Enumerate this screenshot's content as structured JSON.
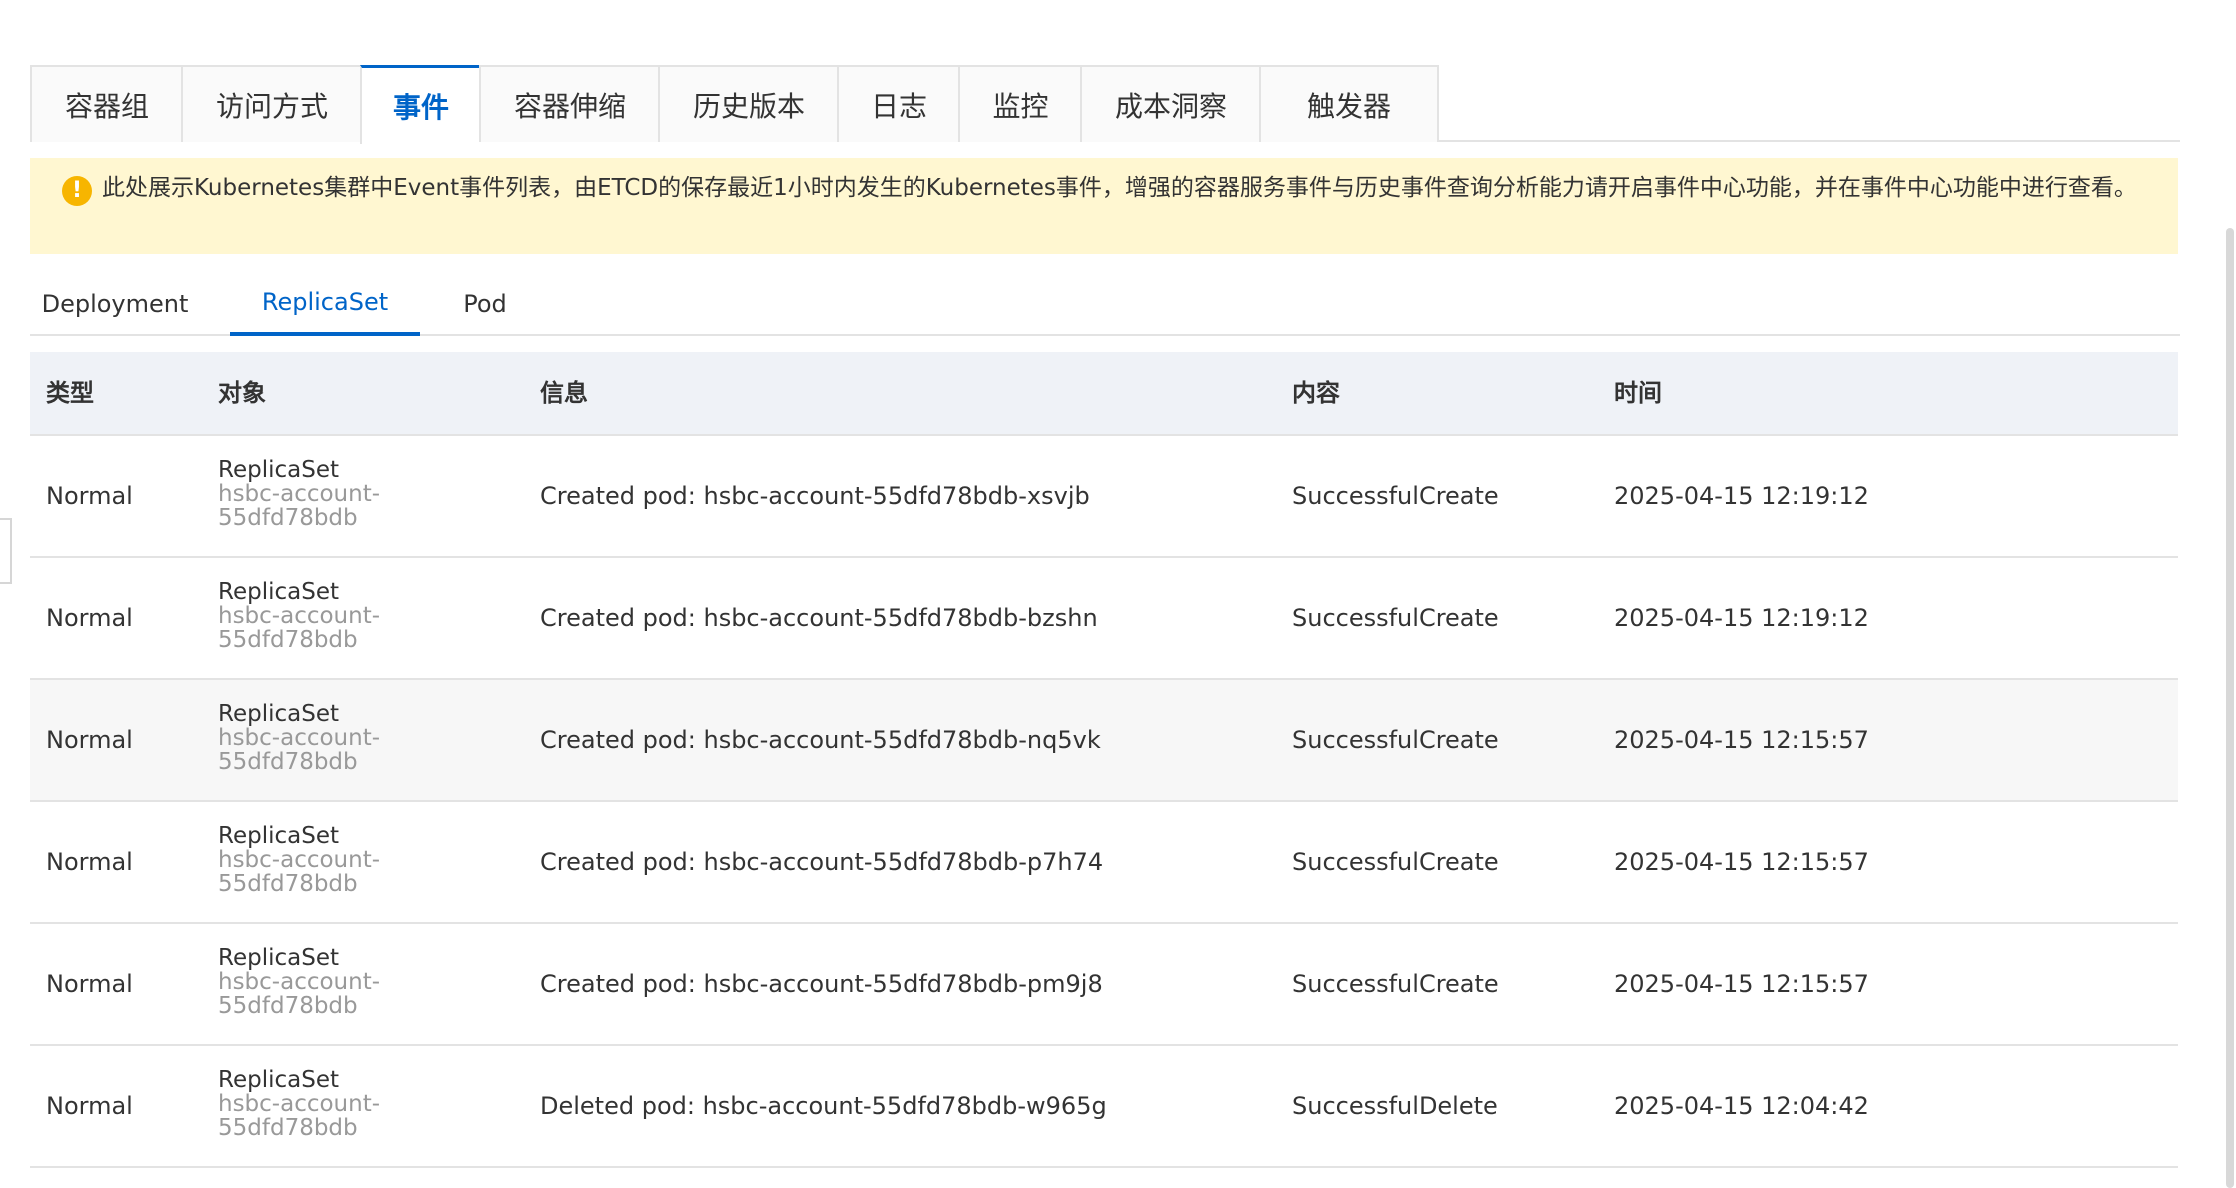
{
  "main_tabs": [
    {
      "label": "容器组"
    },
    {
      "label": "访问方式"
    },
    {
      "label": "事件"
    },
    {
      "label": "容器伸缩"
    },
    {
      "label": "历史版本"
    },
    {
      "label": "日志"
    },
    {
      "label": "监控"
    },
    {
      "label": "成本洞察"
    },
    {
      "label": "触发器"
    }
  ],
  "active_main_tab": "事件",
  "notice": {
    "icon": "warning-icon",
    "text": "此处展示Kubernetes集群中Event事件列表，由ETCD的保存最近1小时内发生的Kubernetes事件，增强的容器服务事件与历史事件查询分析能力请开启事件中心功能，并在事件中心功能中进行查看。"
  },
  "sub_tabs": [
    {
      "label": "Deployment"
    },
    {
      "label": "ReplicaSet"
    },
    {
      "label": "Pod"
    }
  ],
  "active_sub_tab": "ReplicaSet",
  "table": {
    "headers": {
      "type": "类型",
      "object": "对象",
      "message": "信息",
      "reason": "内容",
      "time": "时间"
    },
    "rows": [
      {
        "type": "Normal",
        "kind": "ReplicaSet",
        "name": "hsbc-account-55dfd78bdb",
        "message": "Created pod: hsbc-account-55dfd78bdb-xsvjb",
        "reason": "SuccessfulCreate",
        "time": "2025-04-15 12:19:12"
      },
      {
        "type": "Normal",
        "kind": "ReplicaSet",
        "name": "hsbc-account-55dfd78bdb",
        "message": "Created pod: hsbc-account-55dfd78bdb-bzshn",
        "reason": "SuccessfulCreate",
        "time": "2025-04-15 12:19:12"
      },
      {
        "type": "Normal",
        "kind": "ReplicaSet",
        "name": "hsbc-account-55dfd78bdb",
        "message": "Created pod: hsbc-account-55dfd78bdb-nq5vk",
        "reason": "SuccessfulCreate",
        "time": "2025-04-15 12:15:57"
      },
      {
        "type": "Normal",
        "kind": "ReplicaSet",
        "name": "hsbc-account-55dfd78bdb",
        "message": "Created pod: hsbc-account-55dfd78bdb-p7h74",
        "reason": "SuccessfulCreate",
        "time": "2025-04-15 12:15:57"
      },
      {
        "type": "Normal",
        "kind": "ReplicaSet",
        "name": "hsbc-account-55dfd78bdb",
        "message": "Created pod: hsbc-account-55dfd78bdb-pm9j8",
        "reason": "SuccessfulCreate",
        "time": "2025-04-15 12:15:57"
      },
      {
        "type": "Normal",
        "kind": "ReplicaSet",
        "name": "hsbc-account-55dfd78bdb",
        "message": "Deleted pod: hsbc-account-55dfd78bdb-w965g",
        "reason": "SuccessfulDelete",
        "time": "2025-04-15 12:04:42"
      }
    ]
  },
  "colors": {
    "accent": "#0064c8",
    "notice_bg": "#fff7d1",
    "warning": "#f7b500",
    "header_bg": "#eff2f7"
  }
}
